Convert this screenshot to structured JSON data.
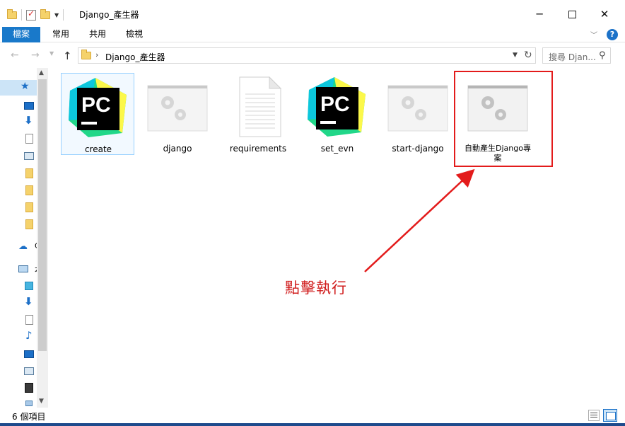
{
  "window": {
    "title": "Django_產生器",
    "minimize_label": "─",
    "close_label": "✕"
  },
  "ribbon": {
    "tabs": [
      {
        "label": "檔案"
      },
      {
        "label": "常用"
      },
      {
        "label": "共用"
      },
      {
        "label": "檢視"
      }
    ],
    "help_label": "?"
  },
  "address": {
    "path": "Django_產生器",
    "separator": "›"
  },
  "search": {
    "placeholder": "搜尋 Djan..."
  },
  "navpane": {
    "visible_labels": [
      "C",
      "本"
    ]
  },
  "files": [
    {
      "name": "create",
      "icon": "pycharm-icon",
      "selected": false,
      "focused": true
    },
    {
      "name": "django",
      "icon": "settings-file-icon",
      "selected": false,
      "focused": false
    },
    {
      "name": "requirements",
      "icon": "text-document-icon",
      "selected": false,
      "focused": false
    },
    {
      "name": "set_evn",
      "icon": "pycharm-icon",
      "selected": false,
      "focused": false
    },
    {
      "name": "start-django",
      "icon": "settings-file-icon",
      "selected": false,
      "focused": false
    },
    {
      "name": "自動產生Django專案",
      "icon": "settings-file-icon",
      "selected": false,
      "focused": false,
      "highlighted": true
    }
  ],
  "annotation": {
    "text": "點擊執行",
    "color": "#d01c1c"
  },
  "status": {
    "item_count": "6 個項目"
  },
  "colors": {
    "accent": "#1979ca",
    "highlight_red": "#e31b1b",
    "selection": "#cce4f7"
  }
}
